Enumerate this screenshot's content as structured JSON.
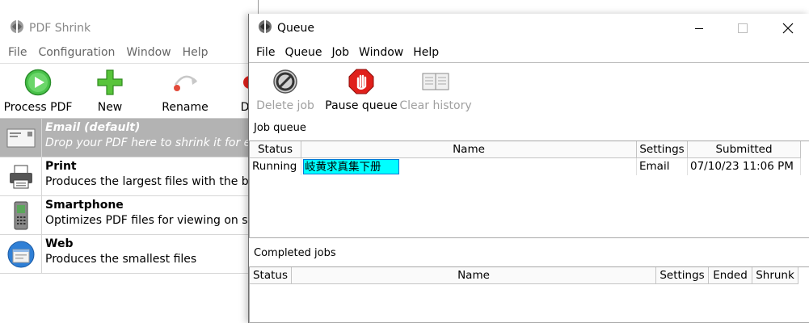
{
  "background_window": {
    "title": "PDF Shrink",
    "menu": [
      "File",
      "Configuration",
      "Window",
      "Help"
    ],
    "toolbar": {
      "process": "Process PDF",
      "new": "New",
      "rename": "Rename",
      "truncated": "D"
    },
    "profiles": [
      {
        "title": "Email (default)",
        "description": "Drop your PDF here to shrink it for em",
        "selected": true,
        "icon": "envelope-icon"
      },
      {
        "title": "Print",
        "description": "Produces the largest files with the bes",
        "selected": false,
        "icon": "printer-icon"
      },
      {
        "title": "Smartphone",
        "description": "Optimizes PDF files for viewing on smar",
        "selected": false,
        "icon": "phone-icon"
      },
      {
        "title": "Web",
        "description": "Produces the smallest files",
        "selected": false,
        "icon": "globe-icon"
      }
    ]
  },
  "queue_window": {
    "title": "Queue",
    "menu": [
      "File",
      "Queue",
      "Job",
      "Window",
      "Help"
    ],
    "toolbar": {
      "delete_job": "Delete job",
      "pause_queue": "Pause queue",
      "clear_history": "Clear history"
    },
    "job_queue": {
      "label": "Job queue",
      "columns": [
        "Status",
        "Name",
        "Settings",
        "Submitted"
      ],
      "rows": [
        {
          "status": "Running",
          "name": "岐黄求真集下册",
          "settings": "Email",
          "submitted": "07/10/23 11:06 PM"
        }
      ]
    },
    "completed_jobs": {
      "label": "Completed jobs",
      "columns": [
        "Status",
        "Name",
        "Settings",
        "Ended",
        "Shrunk"
      ]
    }
  },
  "colors": {
    "selection_highlight": "#00ffff",
    "selected_profile_bg": "#b3b3b3",
    "pause_red": "#e0201b",
    "process_green": "#3dbb3d"
  }
}
